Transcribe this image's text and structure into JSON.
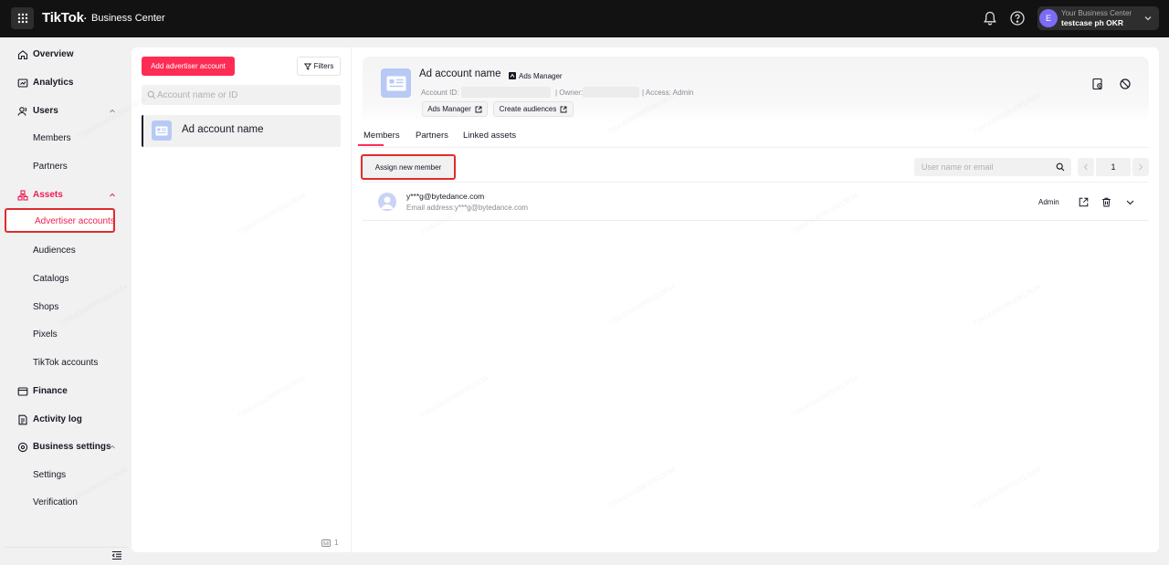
{
  "topbar": {
    "logo": "TikTok",
    "logo_dot": "·",
    "product": "Business Center",
    "account_initial": "E",
    "account_label": "Your Business Center",
    "account_name": "testcase ph OKR",
    "icons": [
      "apps-grid-icon",
      "bell-icon",
      "help-icon",
      "chevron-down-icon"
    ]
  },
  "sidebar": {
    "items": [
      {
        "label": "Overview",
        "icon": "home-icon"
      },
      {
        "label": "Analytics",
        "icon": "analytics-icon"
      },
      {
        "label": "Users",
        "icon": "users-icon"
      },
      {
        "label": "Members"
      },
      {
        "label": "Partners"
      },
      {
        "label": "Assets",
        "icon": "assets-icon"
      },
      {
        "label": "Advertiser accounts"
      },
      {
        "label": "Audiences"
      },
      {
        "label": "Catalogs"
      },
      {
        "label": "Shops"
      },
      {
        "label": "Pixels"
      },
      {
        "label": "TikTok accounts"
      },
      {
        "label": "Finance",
        "icon": "finance-icon"
      },
      {
        "label": "Activity log",
        "icon": "activity-icon"
      },
      {
        "label": "Business settings",
        "icon": "settings-icon"
      },
      {
        "label": "Settings"
      },
      {
        "label": "Verification"
      }
    ],
    "accent": "#ee1d52"
  },
  "list_panel": {
    "add_button": "Add advertiser account",
    "filters_button": "Filters",
    "search_placeholder": "Account name or ID",
    "accounts": [
      {
        "name": "Ad account name"
      }
    ],
    "count": "1"
  },
  "detail": {
    "title": "Ad account name",
    "badge": "Ads Manager",
    "account_id_label": "Account ID:",
    "owner_label": "| Owner:",
    "access": "| Access: Admin",
    "ads_manager_button": "Ads Manager",
    "create_audiences_button": "Create audiences",
    "tabs": [
      "Members",
      "Partners",
      "Linked assets"
    ],
    "assign_button": "Assign new member",
    "member_search_placeholder": "User name or email",
    "page": "1",
    "members": [
      {
        "email": "y***g@bytedance.com",
        "sub": "Email address:y***g@bytedance.com",
        "role": "Admin"
      }
    ]
  },
  "watermark": "7396426409930813634",
  "colors": {
    "brand": "#fe2c55",
    "highlight": "#e02c2c",
    "topbar": "#121212"
  }
}
